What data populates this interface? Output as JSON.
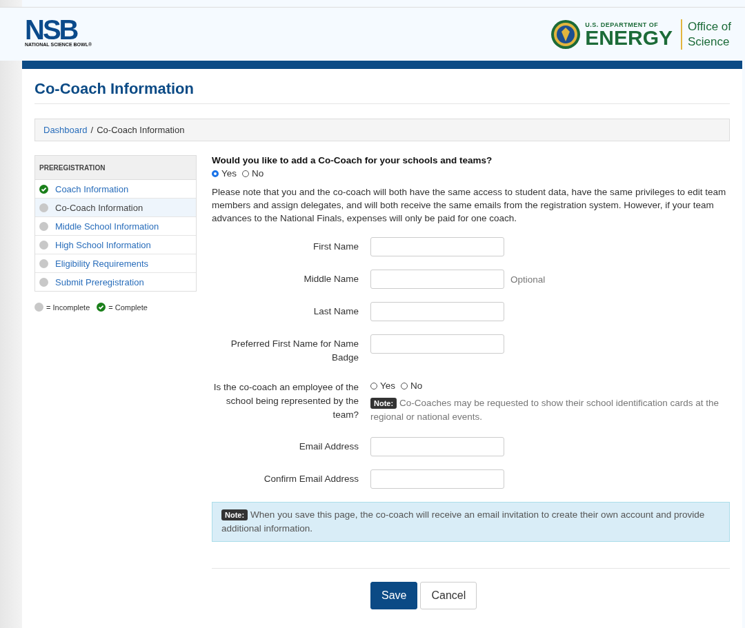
{
  "header": {
    "nsb_logo": {
      "mark": "NSB",
      "tagline": "NATIONAL SCIENCE BOWL®"
    },
    "doe_logo": {
      "department": "U.S. DEPARTMENT OF",
      "name": "ENERGY",
      "office": [
        "Office of",
        "Science"
      ]
    }
  },
  "page_title": "Co-Coach Information",
  "breadcrumb": [
    {
      "label": "Dashboard",
      "kind": "link"
    },
    {
      "label": "/",
      "kind": "separator"
    },
    {
      "label": "Co-Coach Information",
      "kind": "current"
    }
  ],
  "sidebar": {
    "heading": "PREREGISTRATION",
    "items": [
      {
        "label": "Coach Information",
        "complete": true,
        "selected": false
      },
      {
        "label": "Co-Coach Information",
        "complete": false,
        "selected": true
      },
      {
        "label": "Middle School Information",
        "complete": false,
        "selected": false
      },
      {
        "label": "High School Information",
        "complete": false,
        "selected": false
      },
      {
        "label": "Eligibility Requirements",
        "complete": false,
        "selected": false
      },
      {
        "label": "Submit Preregistration",
        "complete": false,
        "selected": false
      }
    ]
  },
  "legend": [
    {
      "complete": false,
      "label": "= Incomplete"
    },
    {
      "complete": true,
      "label": "= Complete"
    }
  ],
  "question": {
    "text": "Would you like to add a Co-Coach for your schools and teams?",
    "options": [
      {
        "label": "Yes",
        "selected": true
      },
      {
        "label": "No",
        "selected": false
      }
    ]
  },
  "notice": "Please note that you and the co-coach will both have the same access to student data, have the same privileges to edit team members and assign delegates, and will both receive the same emails from the registration system. However, if your team advances to the National Finals, expenses will only be paid for one coach.",
  "fields": [
    {
      "kind": "text",
      "label": "First Name"
    },
    {
      "kind": "text",
      "label": "Middle Name",
      "hint": "Optional"
    },
    {
      "kind": "text",
      "label": "Last Name"
    },
    {
      "kind": "text",
      "label": "Preferred First Name for Name Badge"
    },
    {
      "kind": "radio",
      "label": "Is the co-coach an employee of the school being represented by the team?",
      "options": [
        {
          "label": "Yes",
          "selected": false
        },
        {
          "label": "No",
          "selected": false
        }
      ],
      "note": {
        "badge": "Note:",
        "text": "Co-Coaches may be requested to show their school identification cards at the regional or national events."
      }
    },
    {
      "kind": "text",
      "label": "Email Address"
    },
    {
      "kind": "text",
      "label": "Confirm Email Address"
    }
  ],
  "alert": {
    "badge": "Note:",
    "text": "When you save this page, the co-coach will receive an email invitation to create their own account and provide additional information."
  },
  "buttons": [
    {
      "label": "Save",
      "kind": "primary"
    },
    {
      "label": "Cancel",
      "kind": "secondary"
    }
  ]
}
